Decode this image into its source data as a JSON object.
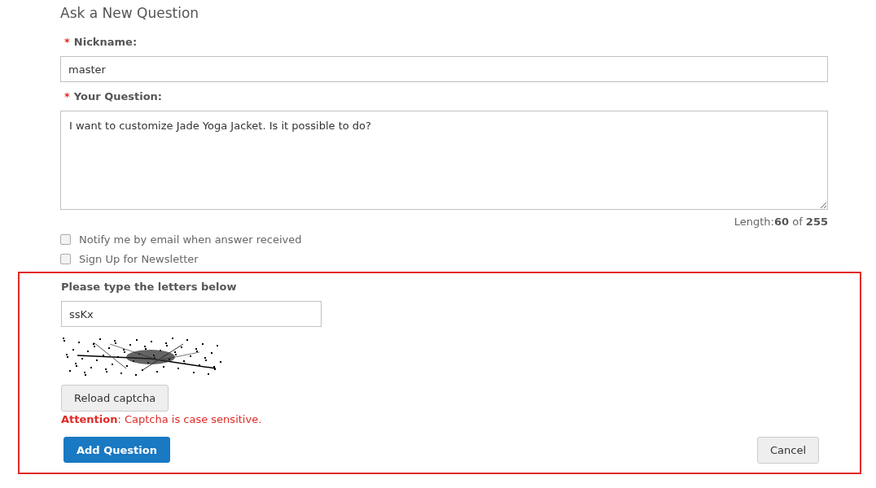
{
  "title": "Ask a New Question",
  "fields": [
    {
      "label": "Nickname:",
      "marker": "*",
      "kind": "input",
      "value": "master"
    },
    {
      "label": "Your Question:",
      "marker": "*",
      "kind": "textarea",
      "value": "I want to customize Jade Yoga Jacket. Is it possible to do?"
    }
  ],
  "length_note": "Length:**60** of **255**",
  "options": [
    {
      "label": "Notify me by email when answer received",
      "checked": false
    },
    {
      "label": "Sign Up for Newsletter",
      "checked": false
    }
  ],
  "captcha": {
    "label": "Please type the letters below",
    "value": "ssKx",
    "reload_button": "Reload captcha",
    "notice": "**Attention**: Captcha is case sensitive."
  },
  "buttons": {
    "submit": "Add Question",
    "cancel": "Cancel"
  }
}
